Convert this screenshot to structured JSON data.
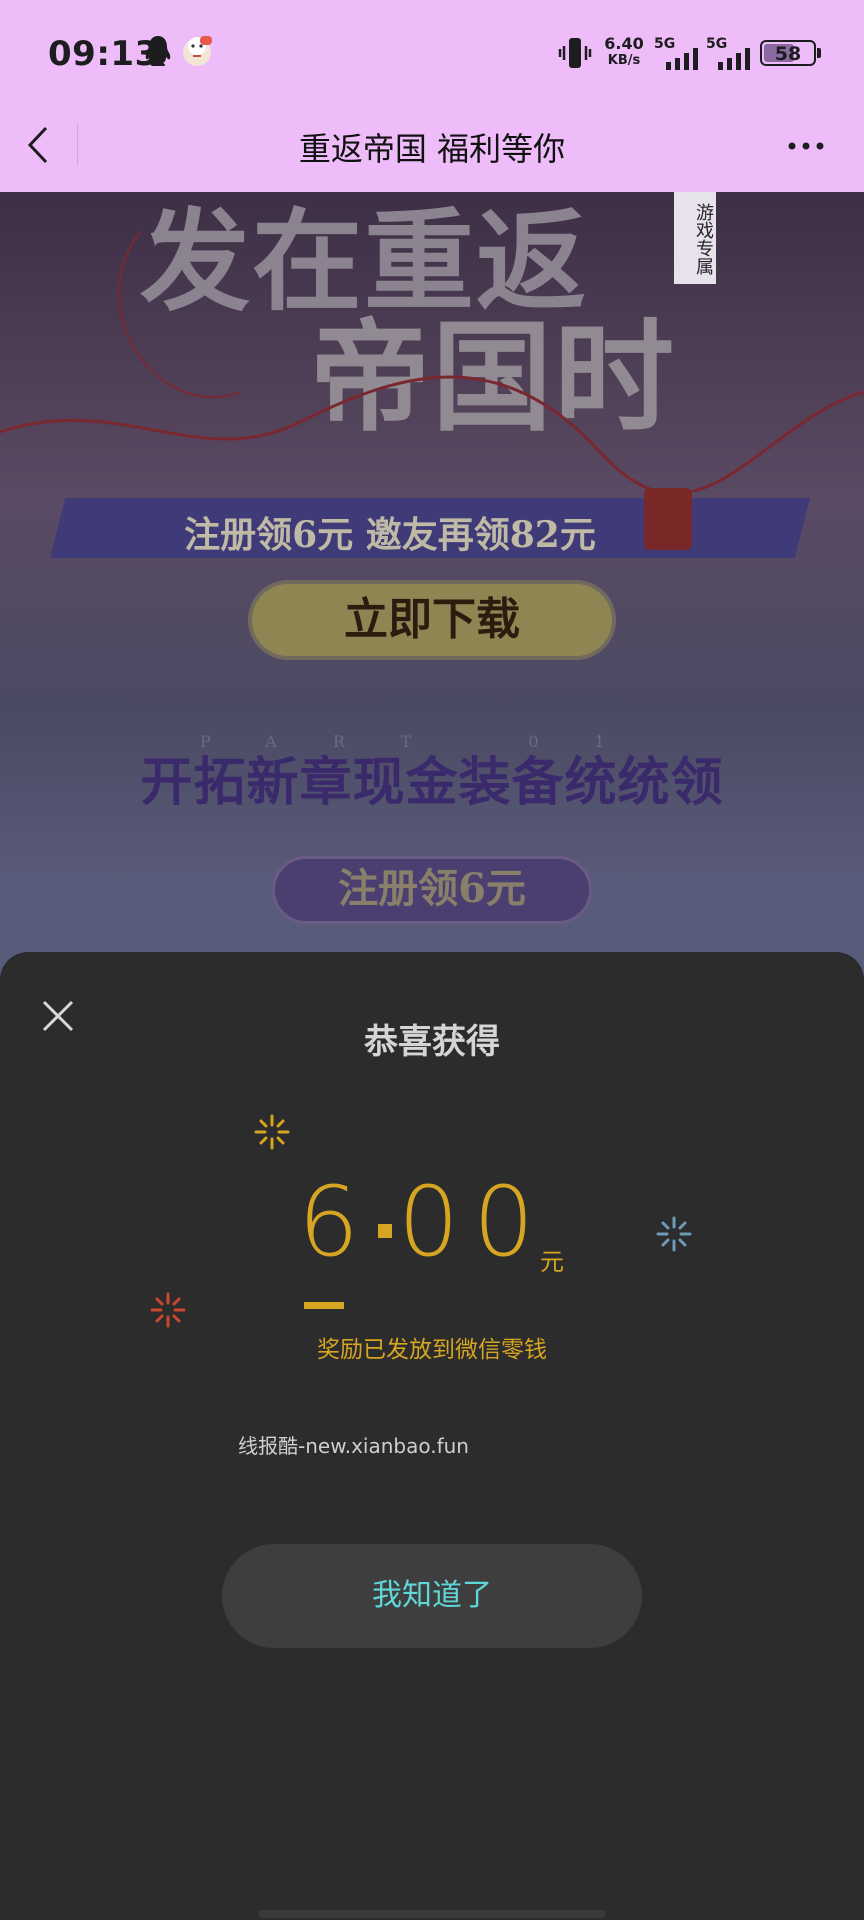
{
  "status_bar": {
    "time": "09:13",
    "net_speed_value": "6.40",
    "net_speed_unit": "KB/s",
    "signal1_label": "5G",
    "signal2_label": "5G",
    "battery": "58",
    "icons": [
      "qq-icon",
      "pet-app-icon",
      "vibrate-icon",
      "signal-icon",
      "battery-icon"
    ]
  },
  "nav": {
    "title": "重返帝国 福利等你",
    "icons": [
      "back-chevron-icon",
      "more-dots-icon"
    ]
  },
  "banner": {
    "hero_line1": "发在重返",
    "hero_line2": "帝国时",
    "tag": "游戏专属",
    "ribbon": "注册领6元   邀友再领82元",
    "download_button": "立即下载",
    "decor_letters": "PART 01",
    "section_title": "开拓新章现金装备统统领",
    "register_pill": "注册领6元"
  },
  "modal": {
    "title": "恭喜获得",
    "amount_integer": "6",
    "amount_decimal": "00",
    "amount_unit": "元",
    "reward_message": "奖励已发放到微信零钱",
    "watermark": "线报酷-new.xianbao.fun",
    "ok_button": "我知道了",
    "colors": {
      "accent_gold": "#d6a521",
      "button_text_cyan": "#5fd6d8",
      "sparkle_blue": "#6f9ab5",
      "sparkle_red": "#c9482e"
    }
  }
}
